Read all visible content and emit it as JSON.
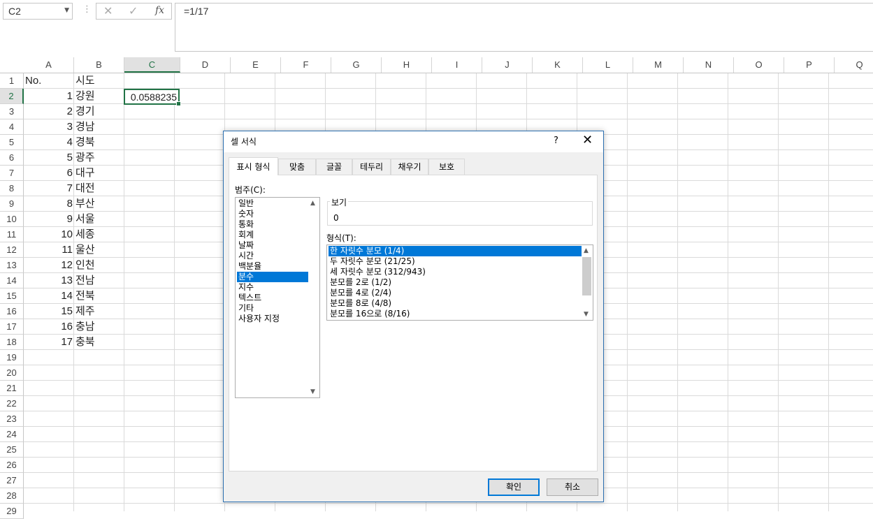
{
  "name_box": "C2",
  "formula_bar": {
    "fx_label": "fx",
    "formula": "=1/17"
  },
  "columns": [
    "A",
    "B",
    "C",
    "D",
    "E",
    "F",
    "G",
    "H",
    "I",
    "J",
    "K",
    "L",
    "M",
    "N",
    "O",
    "P",
    "Q"
  ],
  "rows": [
    "1",
    "2",
    "3",
    "4",
    "5",
    "6",
    "7",
    "8",
    "9",
    "10",
    "11",
    "12",
    "13",
    "14",
    "15",
    "16",
    "17",
    "18",
    "19",
    "20",
    "21",
    "22",
    "23",
    "24",
    "25",
    "26",
    "27",
    "28",
    "29"
  ],
  "sheet": {
    "header_no": "No.",
    "header_sido": "시도",
    "c2_value": "0.0588235",
    "numbers": [
      "1",
      "2",
      "3",
      "4",
      "5",
      "6",
      "7",
      "8",
      "9",
      "10",
      "11",
      "12",
      "13",
      "14",
      "15",
      "16",
      "17"
    ],
    "regions": [
      "강원",
      "경기",
      "경남",
      "경북",
      "광주",
      "대구",
      "대전",
      "부산",
      "서울",
      "세종",
      "울산",
      "인천",
      "전남",
      "전북",
      "제주",
      "충남",
      "충북"
    ]
  },
  "dialog": {
    "title": "셀 서식",
    "help": "?",
    "close": "✕",
    "tabs": [
      "표시 형식",
      "맞춤",
      "글꼴",
      "테두리",
      "채우기",
      "보호"
    ],
    "active_tab": "표시 형식",
    "category_label": "범주(C):",
    "categories": [
      "일반",
      "숫자",
      "통화",
      "회계",
      "날짜",
      "시간",
      "백분율",
      "분수",
      "지수",
      "텍스트",
      "기타",
      "사용자 지정"
    ],
    "selected_category": "분수",
    "sample_label": "보기",
    "sample_value": "0",
    "type_label": "형식(T):",
    "types": [
      "한 자릿수 분모 (1/4)",
      "두 자릿수 분모 (21/25)",
      "세 자릿수 분모 (312/943)",
      "분모를 2로 (1/2)",
      "분모를 4로 (2/4)",
      "분모를 8로 (4/8)",
      "분모를 16으로 (8/16)"
    ],
    "selected_type": "한 자릿수 분모 (1/4)",
    "ok": "확인",
    "cancel": "취소"
  },
  "colors": {
    "excel_green": "#217346",
    "selection_blue": "#0078d7"
  }
}
